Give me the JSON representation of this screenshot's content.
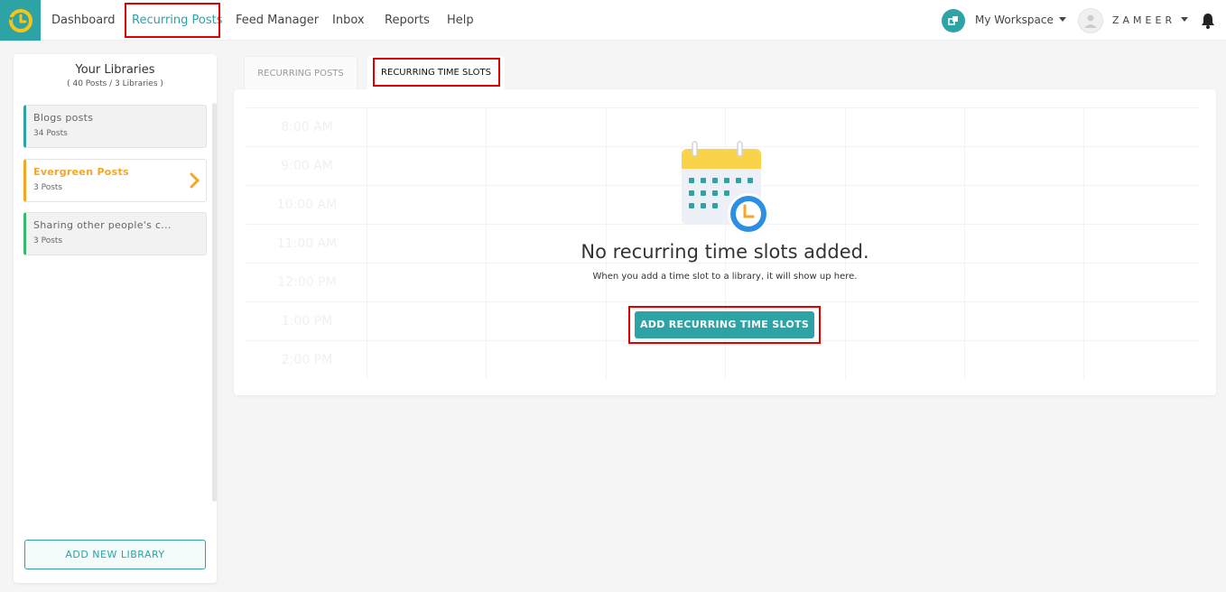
{
  "nav": {
    "items": [
      {
        "label": "Dashboard"
      },
      {
        "label": "Recurring Posts"
      },
      {
        "label": "Feed Manager"
      },
      {
        "label": "Inbox"
      },
      {
        "label": "Reports"
      },
      {
        "label": "Help"
      }
    ],
    "workspace": "My Workspace",
    "user": "ZAMEER"
  },
  "sidebar": {
    "title": "Your Libraries",
    "subtitle": "( 40 Posts / 3 Libraries )",
    "libraries": [
      {
        "name": "Blogs posts",
        "count": "34 Posts"
      },
      {
        "name": "Evergreen Posts",
        "count": "3 Posts"
      },
      {
        "name": "Sharing other people's c...",
        "count": "3 Posts"
      }
    ],
    "add_button": "ADD NEW LIBRARY"
  },
  "tabs": [
    {
      "label": "RECURRING POSTS"
    },
    {
      "label": "RECURRING TIME SLOTS"
    }
  ],
  "schedule": {
    "times": [
      "8:00 AM",
      "9:00 AM",
      "10:00 AM",
      "11:00 AM",
      "12:00 PM",
      "1:00 PM",
      "2:00 PM"
    ]
  },
  "empty_state": {
    "title": "No recurring time slots added.",
    "subtitle": "When you add a time slot to a library, it will show up here.",
    "button": "ADD RECURRING TIME SLOTS"
  },
  "colors": {
    "accent": "#2ea3a6",
    "active_library": "#f5a623",
    "highlight": "#e00000"
  }
}
